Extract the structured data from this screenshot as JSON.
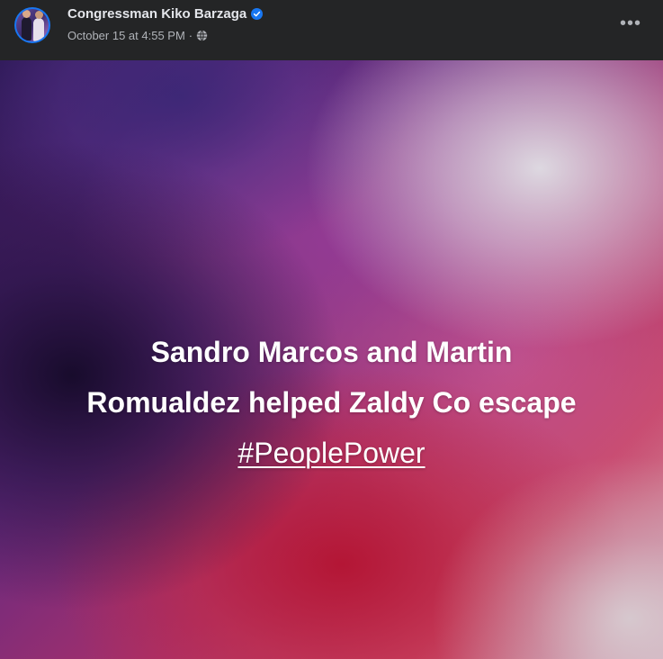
{
  "post": {
    "author": "Congressman Kiko Barzaga",
    "verified": true,
    "timestamp": "October 15 at 4:55 PM",
    "separator": "·",
    "privacy_icon": "globe-icon",
    "more_icon": "more-options-icon",
    "more_label": "•••",
    "text_lines": [
      "Sandro Marcos and Martin",
      "Romualdez helped Zaldy Co escape"
    ],
    "hashtag": "#PeoplePower"
  },
  "colors": {
    "background": "#242526",
    "author_text": "#e4e6eb",
    "meta_text": "#b0b3b8",
    "verified_badge": "#1877f2",
    "post_text": "#ffffff"
  }
}
